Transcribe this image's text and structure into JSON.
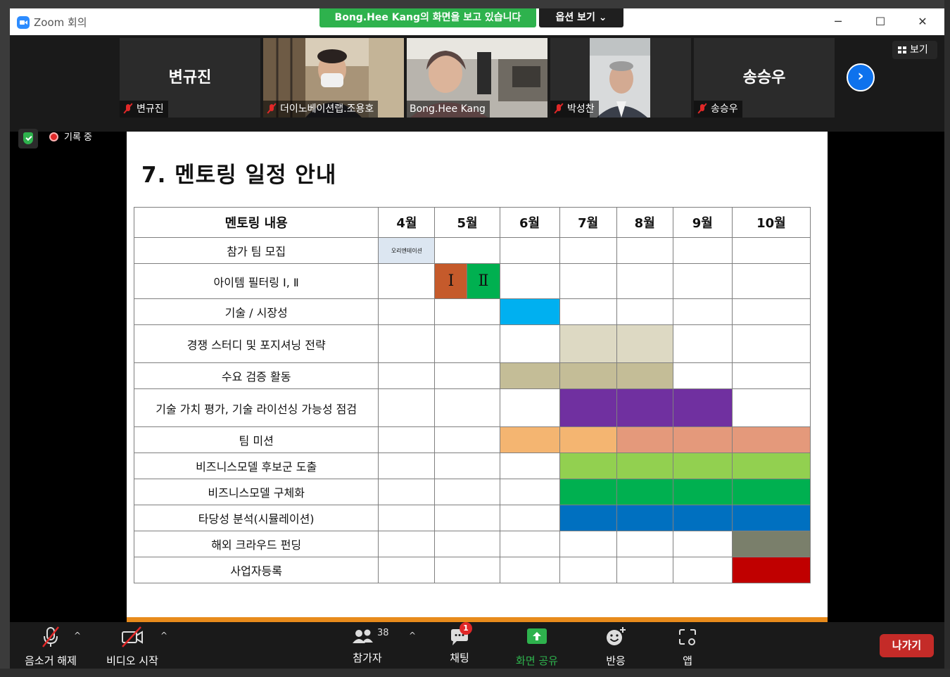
{
  "window": {
    "app_title": "Zoom 회의",
    "share_banner": "Bong.Hee  Kang의 화면을 보고 있습니다",
    "view_options": "옵션 보기 ⌄",
    "minimize": "─",
    "maximize": "☐",
    "close": "✕"
  },
  "participants": {
    "tiles": [
      {
        "big_name": "변규진",
        "name": "변규진",
        "muted": true,
        "video": false
      },
      {
        "big_name": "",
        "name": "더이노베이션랩.조용호",
        "muted": true,
        "video": true
      },
      {
        "big_name": "",
        "name": "Bong.Hee Kang",
        "muted": false,
        "video": true,
        "active": true
      },
      {
        "big_name": "",
        "name": "박성찬",
        "muted": true,
        "video": true
      },
      {
        "big_name": "송승우",
        "name": "송승우",
        "muted": true,
        "video": false
      }
    ],
    "gallery_label": "보기",
    "next_arrow": "›"
  },
  "status": {
    "recording_label": "기록 중"
  },
  "slide": {
    "title": "7. 멘토링 일정 안내",
    "header": {
      "task": "멘토링 내용",
      "months": [
        "4월",
        "5월",
        "6월",
        "7월",
        "8월",
        "9월",
        "10월"
      ]
    },
    "rows": [
      {
        "label": "참가 팀 모집",
        "note": "오리엔테이션"
      },
      {
        "label": "아이템 필터링 Ⅰ, Ⅱ",
        "phase1": "Ⅰ",
        "phase2": "Ⅱ"
      },
      {
        "label": "기술 / 시장성"
      },
      {
        "label": "경쟁 스터디 및 포지셔닝 전략"
      },
      {
        "label": "수요 검증 활동"
      },
      {
        "label": "기술 가치 평가, 기술 라이선싱 가능성 점검"
      },
      {
        "label": "팀 미션"
      },
      {
        "label": "비즈니스모델 후보군 도출"
      },
      {
        "label": "비즈니스모델 구체화"
      },
      {
        "label": "타당성 분석(시뮬레이션)"
      },
      {
        "label": "해외 크라우드 펀딩"
      },
      {
        "label": "사업자등록"
      }
    ],
    "colors": {
      "orientation": "#dce6f1",
      "filter1": "#c55a2b",
      "filter2": "#00b050",
      "tech_market": "#00b0f0",
      "competition": "#ddd9c3",
      "demand": "#c4bd97",
      "valuation": "#7030a0",
      "mission_early": "#f4b571",
      "mission_late": "#e4997b",
      "bm_candidates": "#92d050",
      "bm_concrete": "#00b050",
      "feasibility": "#0070c0",
      "crowdfunding": "#7a7f6b",
      "registration": "#c00000"
    }
  },
  "toolbar": {
    "mute": "음소거 해제",
    "video": "비디오 시작",
    "participants": "참가자",
    "participant_count": "38",
    "chat": "채팅",
    "chat_badge": "1",
    "share": "화면 공유",
    "reactions": "반응",
    "apps": "앱",
    "leave": "나가기",
    "caret": "^"
  }
}
